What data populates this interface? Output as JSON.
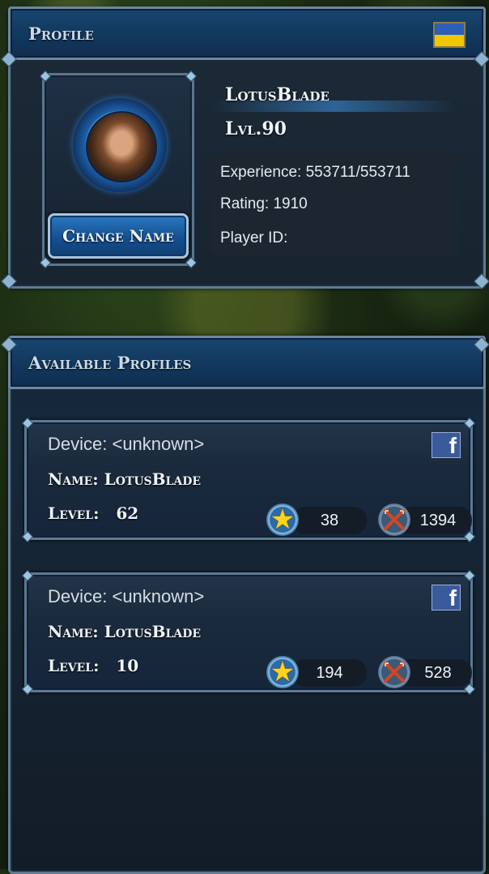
{
  "profile": {
    "header_title": "Profile",
    "flag_icon": "ukraine-flag-icon",
    "flag_colors": {
      "top": "#2e5eb8",
      "bottom": "#f0c800"
    },
    "player_name": "LotusBlade",
    "level": "Lvl.90",
    "change_name_label": "Change Name",
    "experience": "Experience: 553711/553711",
    "rating": "Rating: 1910",
    "player_id": "Player ID:"
  },
  "available_profiles": {
    "header_title": "Available Profiles",
    "cards": [
      {
        "device": "Device: <unknown>",
        "name": "Name: LotusBlade",
        "level_label": "Level:",
        "level_value": "62",
        "stars": "38",
        "battles": "1394",
        "social_icon": "facebook-icon"
      },
      {
        "device": "Device: <unknown>",
        "name": "Name: LotusBlade",
        "level_label": "Level:",
        "level_value": "10",
        "stars": "194",
        "battles": "528",
        "social_icon": "facebook-icon"
      }
    ]
  },
  "colors": {
    "header_blue": "#17456f",
    "accent_button": "#2b78c2",
    "facebook_blue": "#3b5a9c",
    "star_gold": "#ffd21a"
  }
}
